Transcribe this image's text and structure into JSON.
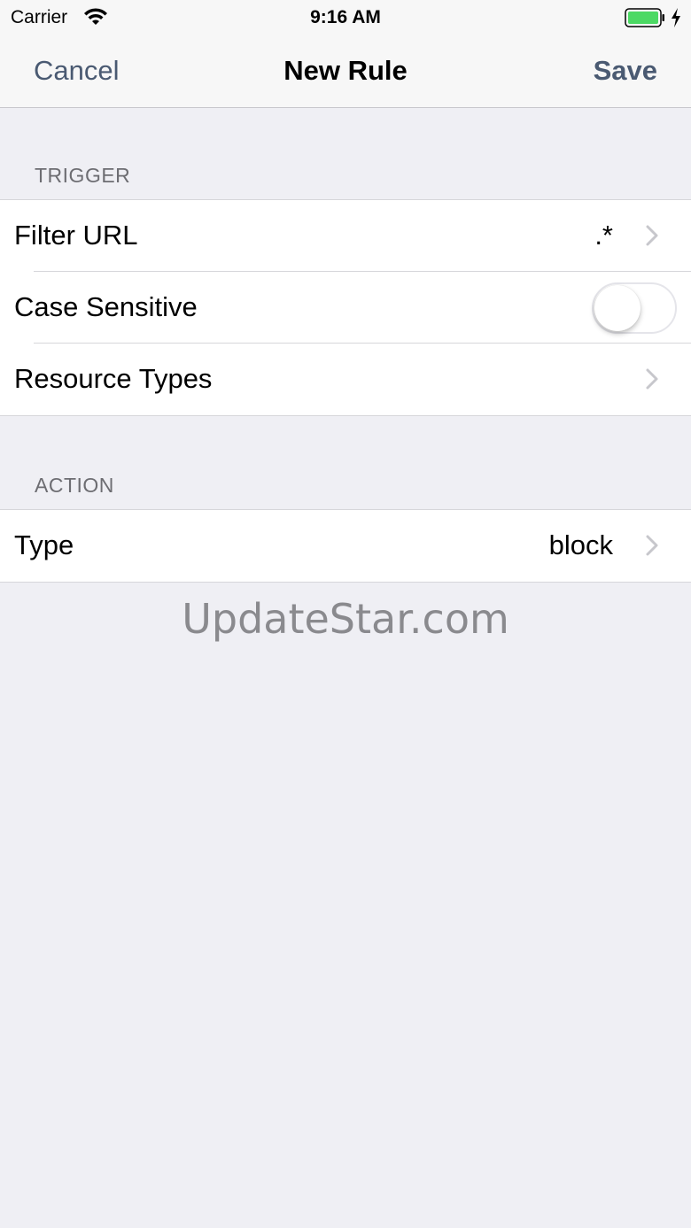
{
  "status_bar": {
    "carrier": "Carrier",
    "time": "9:16 AM",
    "battery_color": "#4cd964"
  },
  "nav": {
    "cancel": "Cancel",
    "title": "New Rule",
    "save": "Save",
    "tint": "#4a5a72"
  },
  "trigger": {
    "header": "TRIGGER",
    "filter_url": {
      "label": "Filter URL",
      "value": ".*"
    },
    "case_sensitive": {
      "label": "Case Sensitive",
      "on": false
    },
    "resource_types": {
      "label": "Resource Types"
    }
  },
  "action": {
    "header": "ACTION",
    "type": {
      "label": "Type",
      "value": "block"
    }
  },
  "watermark": "UpdateStar.com"
}
